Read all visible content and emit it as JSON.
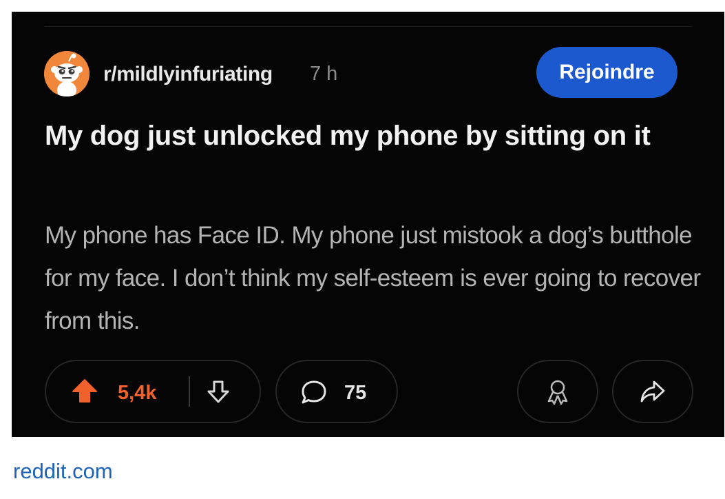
{
  "post": {
    "subreddit": "r/mildlyinfuriating",
    "time_ago": "7 h",
    "join_label": "Rejoindre",
    "title": "My dog just unlocked my phone by sitting on it",
    "body": "My phone has Face ID. My phone just mistook a dog’s butthole for my face. I don’t think my self-esteem is ever going to recover from this."
  },
  "actions": {
    "score": "5,4k",
    "comments": "75"
  },
  "icons": {
    "upvote": "upvote-arrow-icon",
    "downvote": "downvote-arrow-icon",
    "comment": "speech-bubble-icon",
    "award": "award-ribbon-icon",
    "share": "share-arrow-icon",
    "avatar": "reddit-snoo-icon"
  },
  "colors": {
    "card_background": "#050505",
    "join_button": "#1c59cf",
    "upvote_active": "#f0612c",
    "avatar_background": "#f0873a",
    "link": "#1e63b8"
  },
  "footer": {
    "source": "reddit.com"
  }
}
